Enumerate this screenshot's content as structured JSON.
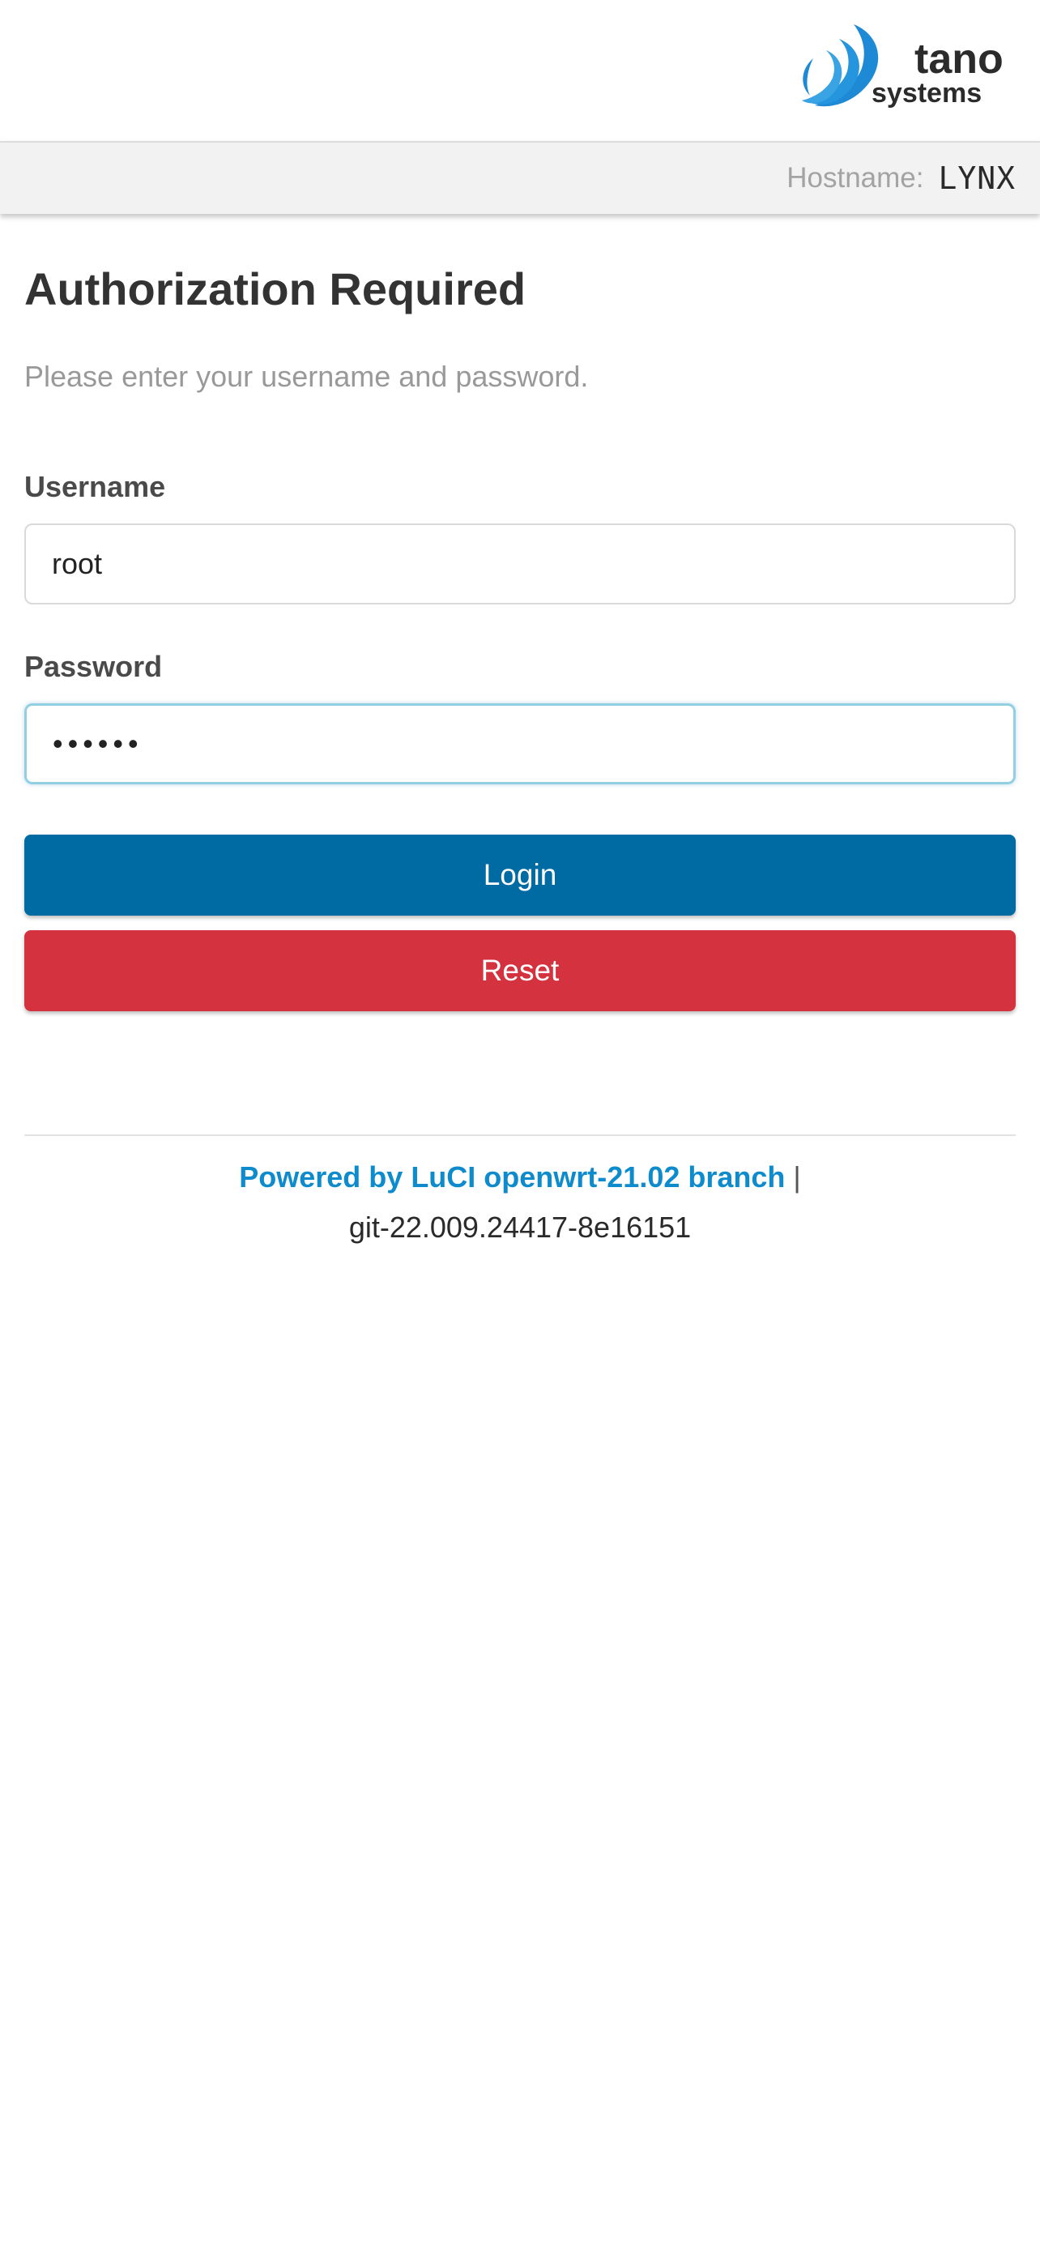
{
  "brand": {
    "logo_line1": "tano",
    "logo_line2": "systems",
    "accent_color": "#1e8ad6"
  },
  "hostbar": {
    "label": "Hostname:",
    "value": "LYNX"
  },
  "page": {
    "title": "Authorization Required",
    "subtitle": "Please enter your username and password."
  },
  "form": {
    "username_label": "Username",
    "username_value": "root",
    "password_label": "Password",
    "password_masked": "••••••",
    "login_label": "Login",
    "reset_label": "Reset",
    "login_color": "#006ba2",
    "reset_color": "#d4323e"
  },
  "footer": {
    "link_text": "Powered by LuCI openwrt-21.02 branch",
    "separator": "|",
    "version": "git-22.009.24417-8e16151"
  }
}
